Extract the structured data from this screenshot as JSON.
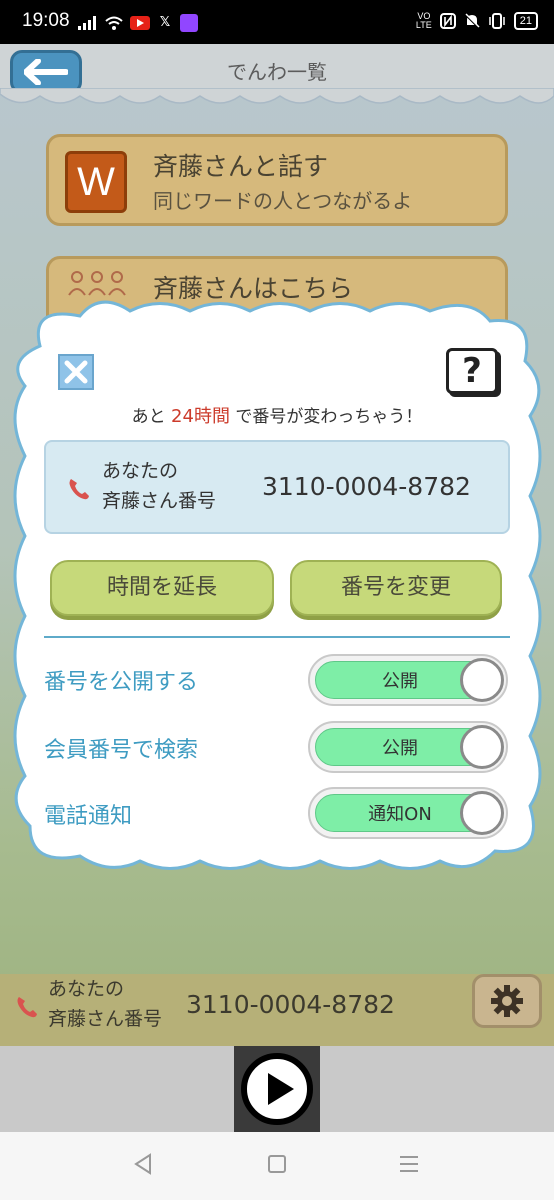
{
  "status_bar": {
    "time": "19:08",
    "battery": "21",
    "icons_left": [
      "signal-icon",
      "wifi-icon",
      "youtube-icon",
      "x-icon",
      "twitch-icon"
    ],
    "icons_right": [
      "volte-icon",
      "nfc-icon",
      "silent-icon",
      "vibrate-icon",
      "battery-icon"
    ]
  },
  "header": {
    "title": "でんわ一覧"
  },
  "list": [
    {
      "title": "斉藤さんと話す",
      "subtitle": "同じワードの人とつながるよ",
      "icon": "W"
    },
    {
      "title": "斉藤さんはこちら"
    }
  ],
  "modal": {
    "countdown_prefix": "あと",
    "countdown_highlight": "24時間",
    "countdown_suffix": "で番号が変わっちゃう！",
    "number_label_line1": "あなたの",
    "number_label_line2": "斉藤さん番号",
    "number": "3110-0004-8782",
    "help_label": "?",
    "extend_button": "時間を延長",
    "change_button": "番号を変更",
    "settings": [
      {
        "label": "番号を公開する",
        "toggle_label": "公開",
        "on": true
      },
      {
        "label": "会員番号で検索",
        "toggle_label": "公開",
        "on": true
      },
      {
        "label": "電話通知",
        "toggle_label": "通知ON",
        "on": true
      }
    ]
  },
  "bottom": {
    "label_line1": "あなたの",
    "label_line2": "斉藤さん番号",
    "number": "3110-0004-8782"
  },
  "colors": {
    "accent_blue": "#3f9cc2",
    "toggle_on": "#7eeea7",
    "highlight_red": "#cc3b2b",
    "button_green": "#c6d97a"
  }
}
